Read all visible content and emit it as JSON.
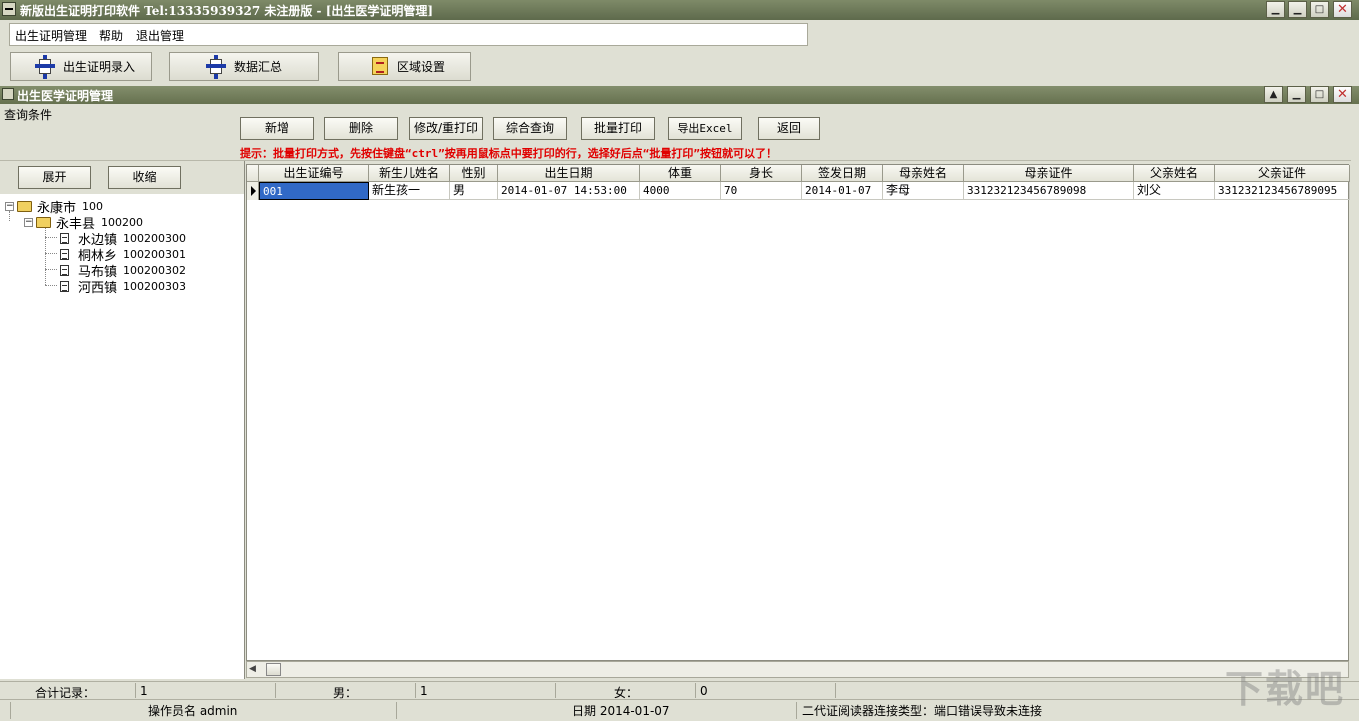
{
  "window": {
    "title": "新版出生证明打印软件  Tel:13335939327 未注册版     - [出生医学证明管理]"
  },
  "menu": [
    "出生证明管理",
    "帮助",
    "退出管理"
  ],
  "toolbar": {
    "birth_entry": "出生证明录入",
    "data_summary": "数据汇总",
    "area_settings": "区域设置"
  },
  "child_window": {
    "title": "出生医学证明管理"
  },
  "query": {
    "label": "查询条件",
    "buttons": {
      "add": "新增",
      "delete": "删除",
      "edit_reprint": "修改/重打印",
      "search": "综合查询",
      "batch_print": "批量打印",
      "export_excel": "导出Excel",
      "back": "返回"
    },
    "hint": "提示：批量打印方式，先按住键盘“ctrl”按再用鼠标点中要打印的行，选择好后点“批量打印”按钮就可以了！"
  },
  "tree": {
    "expand": "展开",
    "collapse": "收缩",
    "nodes": [
      {
        "name": "永康市",
        "code": "100"
      },
      {
        "name": "永丰县",
        "code": "100200"
      },
      {
        "name": "水边镇",
        "code": "100200300"
      },
      {
        "name": "桐林乡",
        "code": "100200301"
      },
      {
        "name": "马布镇",
        "code": "100200302"
      },
      {
        "name": "河西镇",
        "code": "100200303"
      }
    ]
  },
  "table": {
    "columns": [
      "出生证编号",
      "新生儿姓名",
      "性别",
      "出生日期",
      "体重",
      "身长",
      "签发日期",
      "母亲姓名",
      "母亲证件",
      "父亲姓名",
      "父亲证件"
    ],
    "rows": [
      [
        "001",
        "新生孩一",
        "男",
        "2014-01-07 14:53:00",
        "4000",
        "70",
        "2014-01-07",
        "李母",
        "331232123456789098",
        "刘父",
        "331232123456789095"
      ]
    ]
  },
  "status": {
    "total_label": "合计记录：",
    "total_value": "1",
    "male_label": "男：",
    "male_value": "1",
    "female_label": "女：",
    "female_value": "0",
    "operator": "操作员名 admin",
    "date": "日期  2014-01-07",
    "reader": "二代证阅读器连接类型：端口错误导致未连接"
  },
  "watermark": "下载吧"
}
